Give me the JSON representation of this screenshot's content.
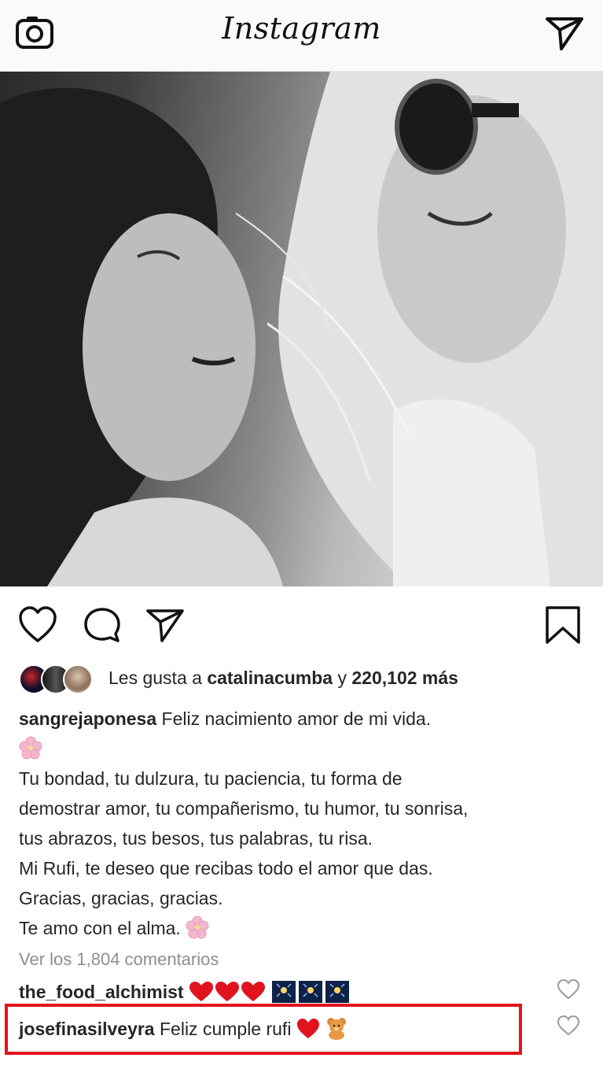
{
  "header": {
    "app_title": "Instagram",
    "camera_icon": "camera-icon",
    "direct_icon": "paper-plane-icon"
  },
  "post": {
    "photo_icon": "post-photo",
    "actions": {
      "like_icon": "heart-outline-icon",
      "comment_icon": "comment-bubble-icon",
      "share_icon": "paper-plane-icon",
      "save_icon": "bookmark-icon"
    },
    "likes": {
      "prefix": "Les gusta a ",
      "user": "catalinacumba",
      "connector": " y ",
      "count": "220,102 más"
    },
    "caption": {
      "username": "sangrejaponesa",
      "line1": " Feliz nacimiento amor de mi vida.",
      "line3": "Tu bondad, tu dulzura, tu paciencia, tu forma de",
      "line4": "demostrar amor, tu compañerismo, tu humor, tu sonrisa,",
      "line5": "tus abrazos, tus besos, tus palabras, tu risa.",
      "line6": "Mi Rufi, te deseo que recibas todo el amor que das.",
      "line7": "Gracias, gracias, gracias.",
      "line8": "Te amo con el alma. "
    },
    "view_all_comments": "Ver los 1,804 comentarios",
    "comments": [
      {
        "username": "the_food_alchimist",
        "text": ""
      },
      {
        "username": "josefinasilveyra",
        "text": " Feliz cumple rufi "
      }
    ]
  },
  "colors": {
    "highlight_border": "#e5131c",
    "heart_red": "#e0141e",
    "muted_text": "#8e8e8e"
  }
}
